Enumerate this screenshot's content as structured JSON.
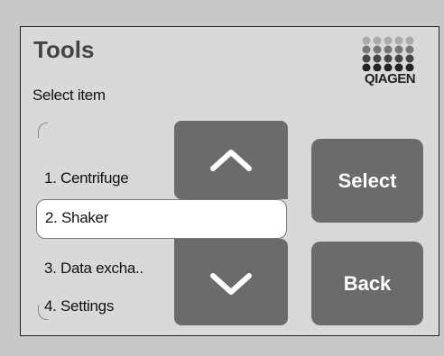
{
  "header": {
    "title": "Tools",
    "subtitle": "Select item",
    "logo_text": "QIAGEN"
  },
  "list": {
    "items": [
      {
        "label": "1. Centrifuge"
      },
      {
        "label": "2. Shaker"
      },
      {
        "label": "3. Data excha.."
      },
      {
        "label": "4. Settings"
      }
    ],
    "selected_index": 1
  },
  "scroll": {
    "up_icon": "chevron-up-icon",
    "down_icon": "chevron-down-icon"
  },
  "actions": {
    "select_label": "Select",
    "back_label": "Back"
  },
  "colors": {
    "button_bg": "#6b6b6b",
    "screen_bg": "#d9d9d9",
    "selected_bg": "#ffffff"
  }
}
